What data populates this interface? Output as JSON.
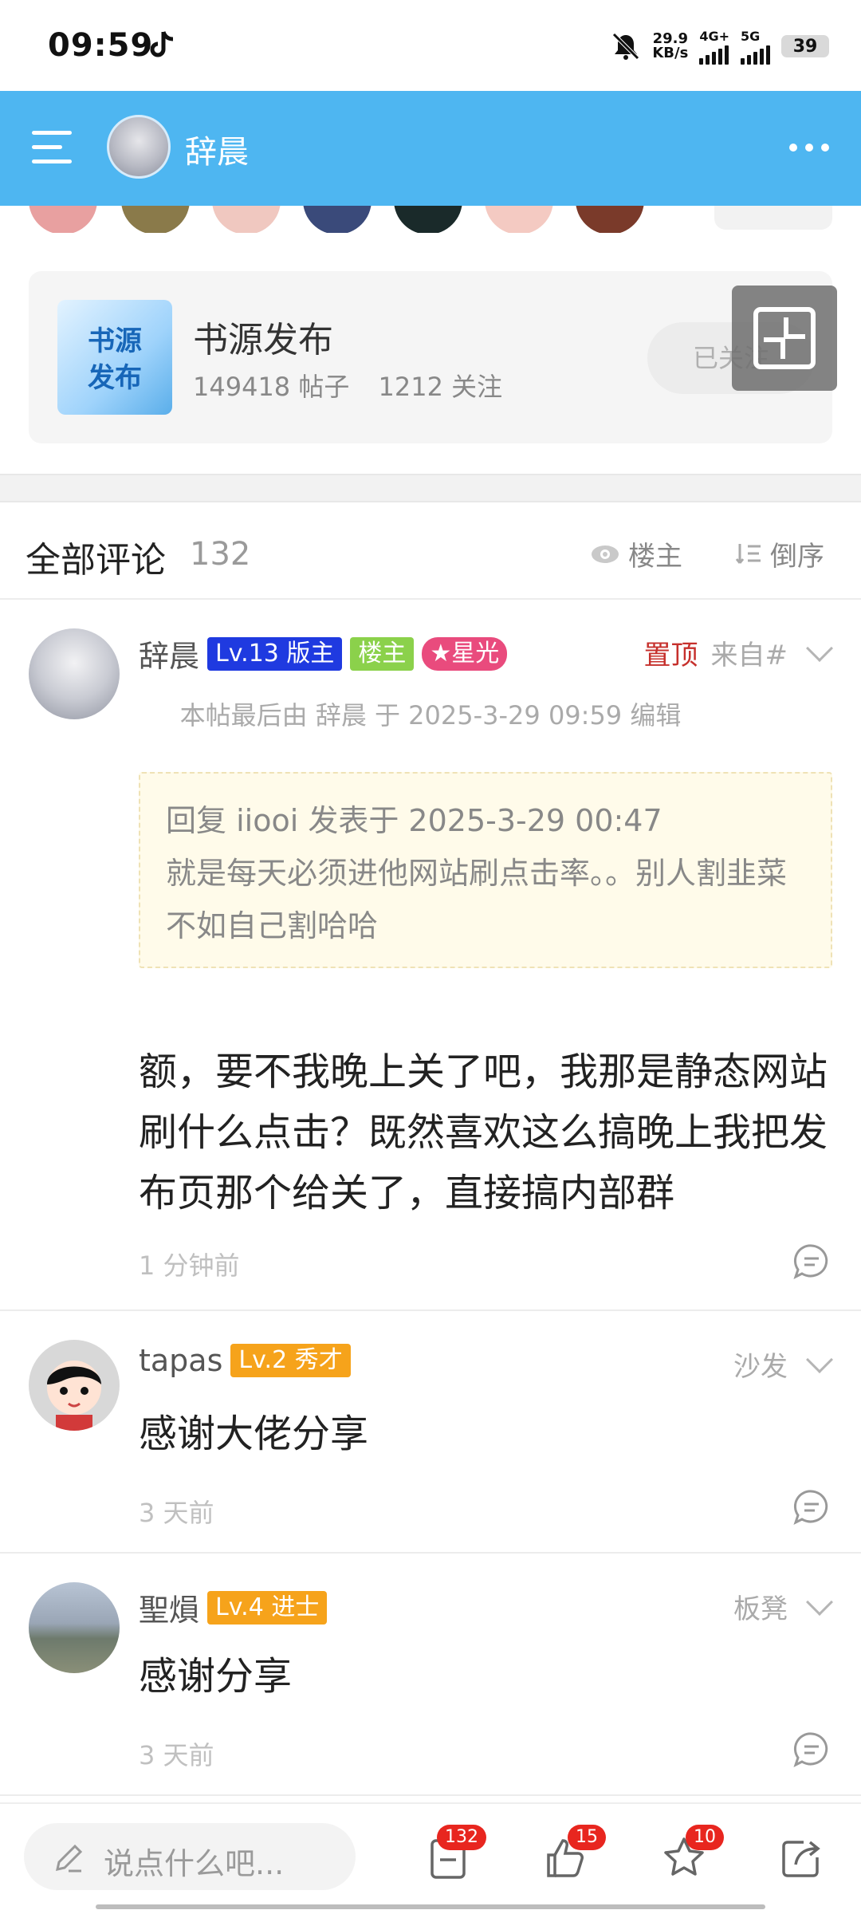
{
  "status_bar": {
    "time": "09:59",
    "net_speed_value": "29.9",
    "net_speed_unit": "KB/s",
    "net_type_1": "4G+",
    "net_type_2": "5G",
    "battery": "39"
  },
  "top_nav": {
    "title": "辞晨"
  },
  "forum": {
    "icon_text_1": "书源",
    "icon_text_2": "发布",
    "name": "书源发布",
    "posts": "149418 帖子",
    "followers": "1212 关注",
    "follow_label": "已关注"
  },
  "comments_header": {
    "title": "全部评论",
    "count": "132",
    "owner_filter": "楼主",
    "sort_label": "倒序"
  },
  "comments": [
    {
      "name": "辞晨",
      "level": "Lv.13 版主",
      "owner_tag": "楼主",
      "star_tag": "★星光",
      "pinned": "置顶",
      "source": "来自#",
      "edit_note": "本帖最后由 辞晨 于 2025-3-29 09:59 编辑",
      "quote_header": "回复 iiooi 发表于 2025-3-29 00:47",
      "quote_body": "就是每天必须进他网站刷点击率。。别人割韭菜不如自己割哈哈",
      "body": "额，要不我晚上关了吧，我那是静态网站刷什么点击？既然喜欢这么搞晚上我把发布页那个给关了，直接搞内部群",
      "time": "1 分钟前"
    },
    {
      "name": "tapas",
      "level": "Lv.2 秀才",
      "floor": "沙发",
      "body": "感谢大佬分享",
      "time": "3 天前"
    },
    {
      "name": "聖熉",
      "level": "Lv.4 进士",
      "floor": "板凳",
      "body": "感谢分享",
      "time": "3 天前"
    }
  ],
  "bottom_bar": {
    "input_placeholder": "说点什么吧...",
    "comments_count": "132",
    "likes_count": "15",
    "favorites_count": "10"
  },
  "colors": {
    "nav_blue": "#4eb6f1",
    "badge_red": "#e8261f",
    "pin_red": "#c6302c",
    "level_blue": "#1f3ae0",
    "level_orange": "#f6a31b",
    "owner_green": "#8bd14b"
  }
}
